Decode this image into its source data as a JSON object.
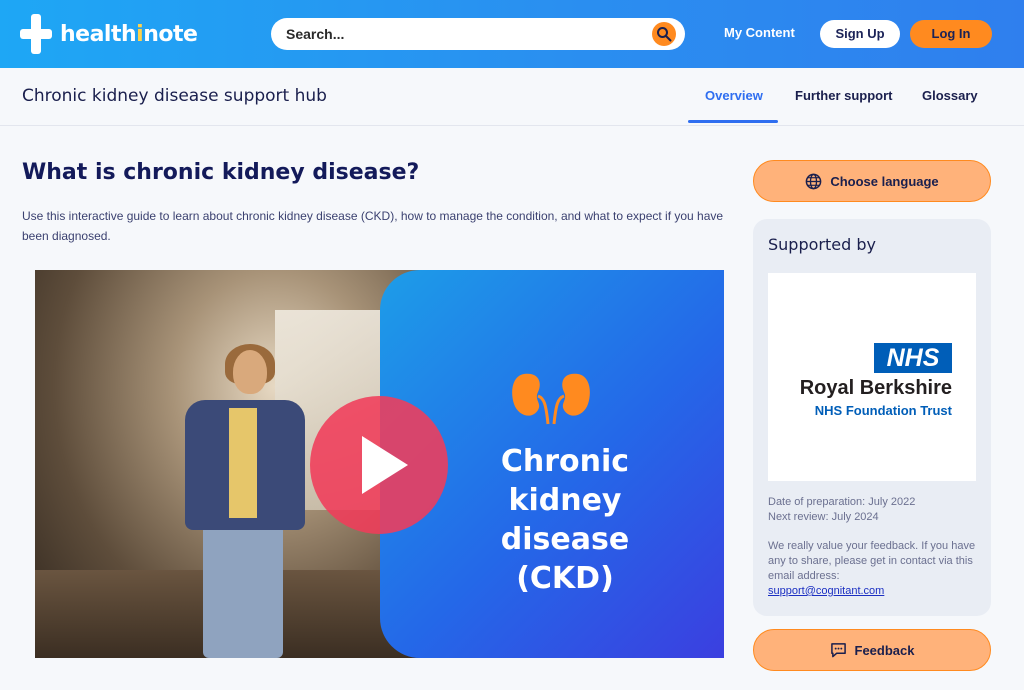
{
  "header": {
    "logo_part1": "health",
    "logo_highlight": "i",
    "logo_part2": "note",
    "search_placeholder": "Search...",
    "my_content": "My Content",
    "sign_up": "Sign Up",
    "log_in": "Log In",
    "search_icon": "search-icon",
    "brand_color": "#2a8ff0",
    "accent_color": "#ff8a1f"
  },
  "subnav": {
    "title": "Chronic kidney disease support hub",
    "tabs": [
      {
        "label": "Overview",
        "active": true
      },
      {
        "label": "Further support",
        "active": false
      },
      {
        "label": "Glossary",
        "active": false
      }
    ]
  },
  "main": {
    "title": "What is chronic kidney disease?",
    "intro": "Use this interactive guide to learn about chronic kidney disease (CKD), how to manage the condition, and what to expect if you have been diagnosed.",
    "video": {
      "title_lines": [
        "Chronic",
        "kidney",
        "disease",
        "(CKD)"
      ],
      "play_icon": "play-icon",
      "kidney_icon": "kidneys-icon"
    }
  },
  "sidebar": {
    "language_button": "Choose language",
    "language_icon": "globe-icon",
    "supported_by": "Supported by",
    "logo": {
      "nhs": "NHS",
      "trust_name": "Royal Berkshire",
      "trust_sub": "NHS Foundation Trust"
    },
    "date_prepared": "Date of preparation: July 2022",
    "next_review": "Next review: July 2024",
    "feedback_text": "We really value your feedback. If you have any to share, please get in contact via this email address:",
    "email": "support@cognitant.com",
    "feedback_button": "Feedback",
    "feedback_icon": "message-icon"
  }
}
